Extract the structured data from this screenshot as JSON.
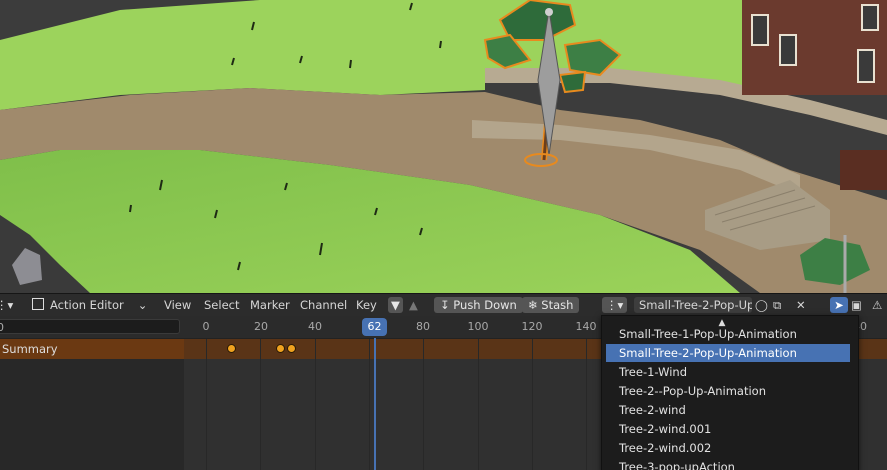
{
  "header": {
    "editor_label": "Action Editor",
    "menus": [
      "View",
      "Select",
      "Marker",
      "Channel",
      "Key"
    ],
    "push_down_label": "Push Down",
    "stash_label": "Stash",
    "action_name": "Small-Tree-2-Pop-Up.."
  },
  "search": {
    "value": "0"
  },
  "ruler": {
    "ticks": [
      "0",
      "20",
      "40",
      "80",
      "100",
      "120",
      "140",
      "40"
    ],
    "current_frame": "62"
  },
  "channels": {
    "summary_label": "Summary"
  },
  "dropdown": {
    "items": [
      "Small-Tree-1-Pop-Up-Animation",
      "Small-Tree-2-Pop-Up-Animation",
      "Tree-1-Wind",
      "Tree-2--Pop-Up-Animation",
      "Tree-2-wind",
      "Tree-2-wind.001",
      "Tree-2-wind.002",
      "Tree-3-pop-upAction"
    ],
    "selected_index": 1
  },
  "colors": {
    "accent": "#4772b3",
    "keyframe": "#f0a21f",
    "summary_row": "#6b3912"
  }
}
